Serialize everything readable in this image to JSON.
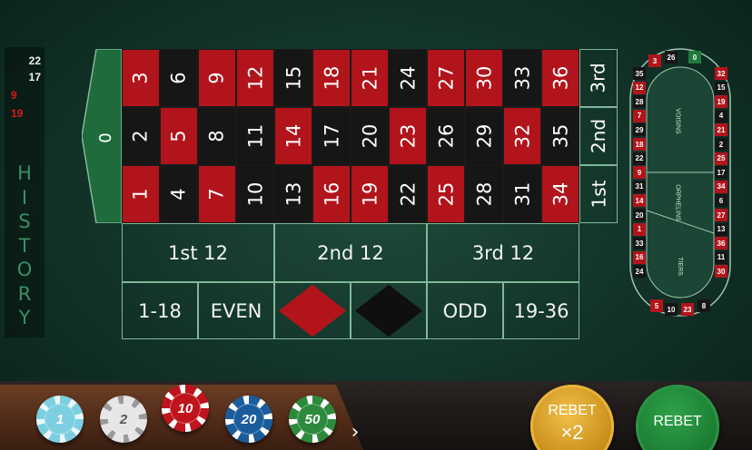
{
  "history": {
    "label": "HISTORY",
    "results": [
      {
        "number": "22",
        "color": "black"
      },
      {
        "number": "17",
        "color": "black"
      },
      {
        "number": "9",
        "color": "red"
      },
      {
        "number": "19",
        "color": "red"
      }
    ]
  },
  "table": {
    "zero": "0",
    "rows": [
      [
        {
          "n": "3",
          "c": "red"
        },
        {
          "n": "6",
          "c": "black"
        },
        {
          "n": "9",
          "c": "red"
        },
        {
          "n": "12",
          "c": "red"
        },
        {
          "n": "15",
          "c": "black"
        },
        {
          "n": "18",
          "c": "red"
        },
        {
          "n": "21",
          "c": "red"
        },
        {
          "n": "24",
          "c": "black"
        },
        {
          "n": "27",
          "c": "red"
        },
        {
          "n": "30",
          "c": "red"
        },
        {
          "n": "33",
          "c": "black"
        },
        {
          "n": "36",
          "c": "red"
        }
      ],
      [
        {
          "n": "2",
          "c": "black"
        },
        {
          "n": "5",
          "c": "red"
        },
        {
          "n": "8",
          "c": "black"
        },
        {
          "n": "11",
          "c": "black"
        },
        {
          "n": "14",
          "c": "red"
        },
        {
          "n": "17",
          "c": "black"
        },
        {
          "n": "20",
          "c": "black"
        },
        {
          "n": "23",
          "c": "red"
        },
        {
          "n": "26",
          "c": "black"
        },
        {
          "n": "29",
          "c": "black"
        },
        {
          "n": "32",
          "c": "red"
        },
        {
          "n": "35",
          "c": "black"
        }
      ],
      [
        {
          "n": "1",
          "c": "red"
        },
        {
          "n": "4",
          "c": "black"
        },
        {
          "n": "7",
          "c": "red"
        },
        {
          "n": "10",
          "c": "black"
        },
        {
          "n": "13",
          "c": "black"
        },
        {
          "n": "16",
          "c": "red"
        },
        {
          "n": "19",
          "c": "red"
        },
        {
          "n": "22",
          "c": "black"
        },
        {
          "n": "25",
          "c": "red"
        },
        {
          "n": "28",
          "c": "black"
        },
        {
          "n": "31",
          "c": "black"
        },
        {
          "n": "34",
          "c": "red"
        }
      ]
    ],
    "columns": [
      "3rd",
      "2nd",
      "1st"
    ],
    "dozens": [
      "1st 12",
      "2nd 12",
      "3rd 12"
    ],
    "outside": {
      "low": "1-18",
      "even": "EVEN",
      "red_label": "",
      "black_label": "",
      "odd": "ODD",
      "high": "19-36"
    },
    "colors": {
      "red": "#b2141b",
      "black": "#161616",
      "felt": "#163e30",
      "zero": "#1f6b3b"
    }
  },
  "racetrack": {
    "sections": [
      "VOISINS",
      "ORPHELINS",
      "TIERS"
    ],
    "left": [
      {
        "n": "35",
        "c": "black"
      },
      {
        "n": "12",
        "c": "red"
      },
      {
        "n": "28",
        "c": "black"
      },
      {
        "n": "7",
        "c": "red"
      },
      {
        "n": "29",
        "c": "black"
      },
      {
        "n": "18",
        "c": "red"
      },
      {
        "n": "22",
        "c": "black"
      },
      {
        "n": "9",
        "c": "red"
      },
      {
        "n": "31",
        "c": "black"
      },
      {
        "n": "14",
        "c": "red"
      },
      {
        "n": "20",
        "c": "black"
      },
      {
        "n": "1",
        "c": "red"
      },
      {
        "n": "33",
        "c": "black"
      },
      {
        "n": "16",
        "c": "red"
      },
      {
        "n": "24",
        "c": "black"
      }
    ],
    "right": [
      {
        "n": "32",
        "c": "red"
      },
      {
        "n": "15",
        "c": "black"
      },
      {
        "n": "19",
        "c": "red"
      },
      {
        "n": "4",
        "c": "black"
      },
      {
        "n": "21",
        "c": "red"
      },
      {
        "n": "2",
        "c": "black"
      },
      {
        "n": "25",
        "c": "red"
      },
      {
        "n": "17",
        "c": "black"
      },
      {
        "n": "34",
        "c": "red"
      },
      {
        "n": "6",
        "c": "black"
      },
      {
        "n": "27",
        "c": "red"
      },
      {
        "n": "13",
        "c": "black"
      },
      {
        "n": "36",
        "c": "red"
      },
      {
        "n": "11",
        "c": "black"
      },
      {
        "n": "30",
        "c": "red"
      }
    ],
    "top": [
      {
        "n": "3",
        "c": "red"
      },
      {
        "n": "26",
        "c": "black"
      },
      {
        "n": "0",
        "c": "green"
      }
    ],
    "bottom": [
      {
        "n": "5",
        "c": "red"
      },
      {
        "n": "10",
        "c": "black"
      },
      {
        "n": "23",
        "c": "red"
      },
      {
        "n": "8",
        "c": "black"
      }
    ]
  },
  "chips": [
    {
      "value": "1",
      "color": "#7ccfe0",
      "edge": "#e8f7fb",
      "text": "#ffffff"
    },
    {
      "value": "2",
      "color": "#e6e6e6",
      "edge": "#9a9a9a",
      "text": "#555555"
    },
    {
      "value": "10",
      "color": "#c0141d",
      "edge": "#ffffff",
      "text": "#ffffff"
    },
    {
      "value": "20",
      "color": "#1a5c9c",
      "edge": "#ffffff",
      "text": "#ffffff"
    },
    {
      "value": "50",
      "color": "#2c8a3c",
      "edge": "#ffffff",
      "text": "#ffffff"
    }
  ],
  "chip_next": "›",
  "buttons": {
    "rebet_x2_label": "REBET",
    "rebet_x2_mult": "×2",
    "rebet_label": "REBET"
  }
}
